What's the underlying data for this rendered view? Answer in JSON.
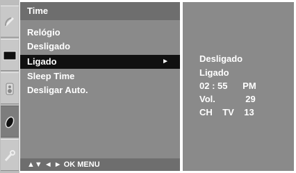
{
  "rail": {
    "icons": [
      "satellite-dish-icon",
      "screen-icon",
      "speaker-icon",
      "clock-icon",
      "wrench-icon"
    ],
    "active_index": 3
  },
  "menu": {
    "title": "Time",
    "items": [
      {
        "label": "Relógio"
      },
      {
        "label": "Desligado"
      },
      {
        "label": "Ligado",
        "arrow": "►",
        "selected": true
      },
      {
        "label": "Sleep Time"
      },
      {
        "label": "Desligar Auto."
      }
    ],
    "footer": "▲▼  ◄ ►  OK  MENU"
  },
  "submenu": {
    "lines": [
      "Desligado",
      "Ligado",
      "02 : 55      PM",
      "Vol.            29",
      "CH    TV    13"
    ]
  },
  "colors": {
    "panel": "#8a8a8a",
    "title_bar": "#6e6e6e",
    "selected_row": "#101010",
    "text": "#ffffff"
  }
}
